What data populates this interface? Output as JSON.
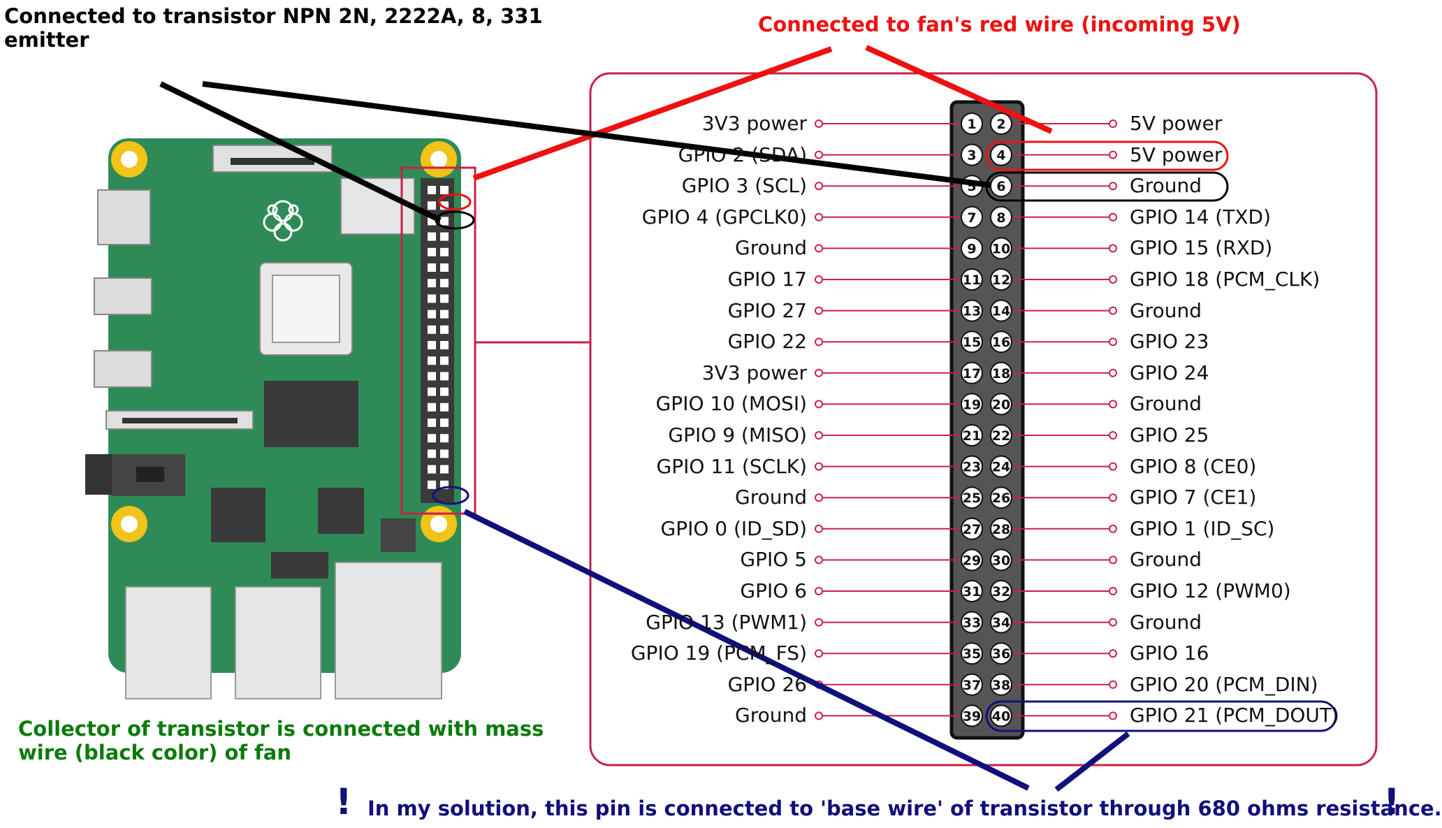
{
  "annotations": {
    "top_left": "Connected to transistor NPN 2N, 2222A, 8, 331 emitter",
    "top_right": "Connected to fan's red wire (incoming 5V)",
    "bottom_left": "Collector of transistor is connected with mass wire (black color) of fan",
    "bottom": "In my solution, this pin is connected to 'base wire' of transistor through 680 ohms resistance.",
    "exclamation": "!"
  },
  "colors": {
    "board": "#2e8b57",
    "header_border": "#c8204a",
    "red_wire": "#ee1111",
    "black_wire": "#000000",
    "navy_wire": "#10107a",
    "green_text": "#0b7a0b",
    "pin_column": "#555555"
  },
  "pins": [
    {
      "num": "1",
      "label": "3V3 power"
    },
    {
      "num": "2",
      "label": "5V power"
    },
    {
      "num": "3",
      "label": "GPIO 2 (SDA)"
    },
    {
      "num": "4",
      "label": "5V power"
    },
    {
      "num": "5",
      "label": "GPIO 3 (SCL)"
    },
    {
      "num": "6",
      "label": "Ground"
    },
    {
      "num": "7",
      "label": "GPIO 4 (GPCLK0)"
    },
    {
      "num": "8",
      "label": "GPIO 14 (TXD)"
    },
    {
      "num": "9",
      "label": "Ground"
    },
    {
      "num": "10",
      "label": "GPIO 15 (RXD)"
    },
    {
      "num": "11",
      "label": "GPIO 17"
    },
    {
      "num": "12",
      "label": "GPIO 18 (PCM_CLK)"
    },
    {
      "num": "13",
      "label": "GPIO 27"
    },
    {
      "num": "14",
      "label": "Ground"
    },
    {
      "num": "15",
      "label": "GPIO 22"
    },
    {
      "num": "16",
      "label": "GPIO 23"
    },
    {
      "num": "17",
      "label": "3V3 power"
    },
    {
      "num": "18",
      "label": "GPIO 24"
    },
    {
      "num": "19",
      "label": "GPIO 10 (MOSI)"
    },
    {
      "num": "20",
      "label": "Ground"
    },
    {
      "num": "21",
      "label": "GPIO 9 (MISO)"
    },
    {
      "num": "22",
      "label": "GPIO 25"
    },
    {
      "num": "23",
      "label": "GPIO 11 (SCLK)"
    },
    {
      "num": "24",
      "label": "GPIO 8 (CE0)"
    },
    {
      "num": "25",
      "label": "Ground"
    },
    {
      "num": "26",
      "label": "GPIO 7 (CE1)"
    },
    {
      "num": "27",
      "label": "GPIO 0 (ID_SD)"
    },
    {
      "num": "28",
      "label": "GPIO 1 (ID_SC)"
    },
    {
      "num": "29",
      "label": "GPIO 5"
    },
    {
      "num": "30",
      "label": "Ground"
    },
    {
      "num": "31",
      "label": "GPIO 6"
    },
    {
      "num": "32",
      "label": "GPIO 12 (PWM0)"
    },
    {
      "num": "33",
      "label": "GPIO 13 (PWM1)"
    },
    {
      "num": "34",
      "label": "Ground"
    },
    {
      "num": "35",
      "label": "GPIO 19 (PCM_FS)"
    },
    {
      "num": "36",
      "label": "GPIO 16"
    },
    {
      "num": "37",
      "label": "GPIO 26"
    },
    {
      "num": "38",
      "label": "GPIO 20 (PCM_DIN)"
    },
    {
      "num": "39",
      "label": "Ground"
    },
    {
      "num": "40",
      "label": "GPIO 21 (PCM_DOUT)"
    }
  ]
}
